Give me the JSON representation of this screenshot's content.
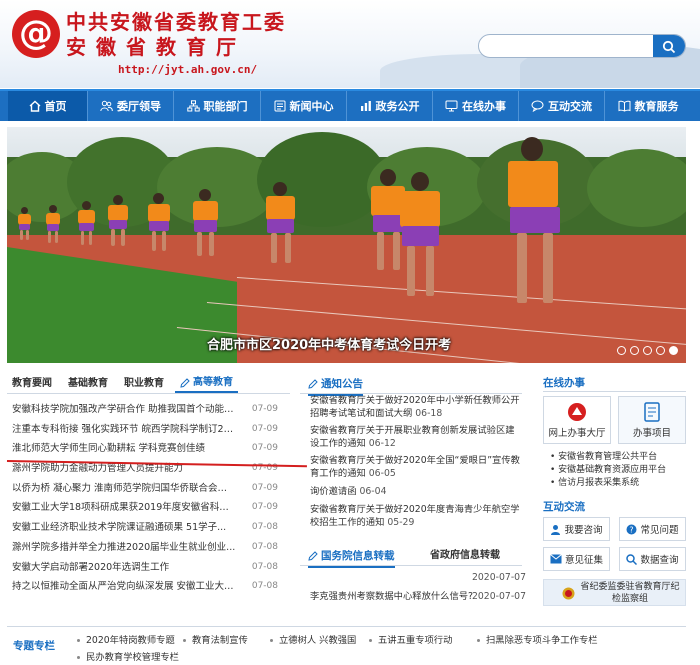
{
  "header": {
    "logo_text": "@",
    "title_line1": "中共安徽省委教育工委",
    "title_line2": "安徽省教育厅",
    "url": "http://jyt.ah.gov.cn/",
    "search_placeholder": "",
    "search_icon": "search-icon"
  },
  "nav": [
    {
      "label": "首页",
      "icon": "home-icon"
    },
    {
      "label": "委厅领导",
      "icon": "users-icon"
    },
    {
      "label": "职能部门",
      "icon": "org-icon"
    },
    {
      "label": "新闻中心",
      "icon": "news-icon"
    },
    {
      "label": "政务公开",
      "icon": "chart-icon"
    },
    {
      "label": "在线办事",
      "icon": "monitor-icon"
    },
    {
      "label": "互动交流",
      "icon": "chat-icon"
    },
    {
      "label": "教育服务",
      "icon": "book-icon"
    }
  ],
  "banner": {
    "caption": "合肥市市区2020年中考体育考试今日开考",
    "slides": 5,
    "active_slide": 5
  },
  "left": {
    "tabs": [
      "教育要闻",
      "基础教育",
      "职业教育",
      "高等教育"
    ],
    "active_tab": 3,
    "news": [
      {
        "title": "安徽科技学院加强改产学研合作 助推我国首个动能农...",
        "date": "07-09"
      },
      {
        "title": "注重本专科衔接 强化实践环节 皖西学院科学制订20...",
        "date": "07-09"
      },
      {
        "title": "淮北师范大学师生同心勤耕耘 学科竞赛创佳绩",
        "date": "07-09"
      },
      {
        "title": "滁州学院助力金融动力管理人员提升能力",
        "date": "07-09"
      },
      {
        "title": "以侨为桥 凝心聚力 淮南师范学院归国华侨联合会正...",
        "date": "07-09"
      },
      {
        "title": "安徽工业大学18项科研成果获2019年度安徽省科学...",
        "date": "07-09"
      },
      {
        "title": "安徽工业经济职业技术学院课证融通硕果 51学子...",
        "date": "07-08"
      },
      {
        "title": "滁州学院多措并举全力推进2020届毕业生就业创业...",
        "date": "07-08"
      },
      {
        "title": "安徽大学启动部署2020年选调生工作",
        "date": "07-08"
      },
      {
        "title": "持之以恒推动全面从严治党向纵深发展 安徽工业大学...",
        "date": "07-08"
      }
    ]
  },
  "mid": {
    "notice_title": "通知公告",
    "notices": [
      {
        "text": "安徽省教育厅关于做好2020年中小学新任教师公开招聘考试笔试和面试大纲",
        "date": "06-18"
      },
      {
        "text": "安徽省教育厅关于开展职业教育创新发展试验区建设工作的通知",
        "date": "06-12"
      },
      {
        "text": "安徽省教育厅关于做好2020年全国“爱眼日”宣传教育工作的通知",
        "date": "06-05"
      },
      {
        "text": "询价邀请函",
        "date": "06-04"
      },
      {
        "text": "安徽省教育厅关于做好2020年度青海青少年航空学校招生工作的通知",
        "date": "05-29"
      }
    ],
    "tabs2": [
      "国务院信息转载",
      "省政府信息转载"
    ],
    "info": [
      {
        "text": "",
        "date": "2020-07-07"
      },
      {
        "text": "李克强贵州考察数据中心释放什么信号?",
        "date": "2020-07-07"
      }
    ]
  },
  "right": {
    "online_title": "在线办事",
    "box1": "网上办事大厅",
    "box2": "办事项目",
    "links": [
      "安徽省教育管理公共平台",
      "安徽基础教育资源应用平台",
      "信访月报表采集系统"
    ],
    "interact_title": "互动交流",
    "buttons": [
      "我要咨询",
      "常见问题",
      "意见征集",
      "数据查询"
    ],
    "party_text": "省纪委监委驻省教育厅纪检监察组"
  },
  "special": {
    "label": "专题专栏",
    "items": [
      "2020年特岗教师专题",
      "教育法制宣传",
      "立德树人 兴教强国",
      "五讲五重专项行动",
      "扫黑除恶专项斗争工作专栏",
      "民办教育学校管理专栏"
    ]
  },
  "colors": {
    "brand_red": "#c8161d",
    "nav_blue": "#1d6fc1",
    "accent_blue": "#1a6fc2"
  }
}
